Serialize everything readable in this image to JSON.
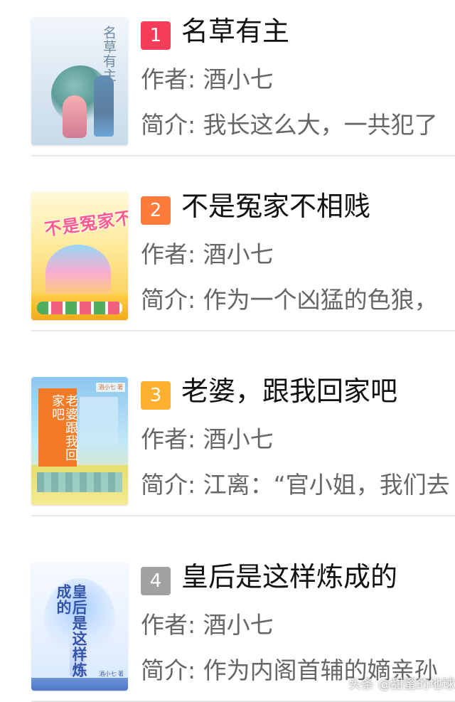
{
  "books": [
    {
      "rank": "1",
      "title": "名草有主",
      "author": "作者: 酒小七",
      "intro": "简介: 我长这么大，一共犯了",
      "rank_color": "#f63c58",
      "cover_text": "名草有主",
      "cover_author": "",
      "cover_theme": "campus"
    },
    {
      "rank": "2",
      "title": "不是冤家不相贱",
      "author": "作者: 酒小七",
      "intro": "简介: 作为一个凶猛的色狼，",
      "rank_color": "#ff7b3c",
      "cover_text": "不是冤家不相贱",
      "cover_author": "",
      "cover_theme": "cartoon"
    },
    {
      "rank": "3",
      "title": "老婆，跟我回家吧",
      "author": "作者: 酒小七",
      "intro": "简介: 江离：“官小姐，我们去",
      "rank_color": "#ffb02f",
      "cover_text": "老婆跟我回家吧",
      "cover_author": "酒小七 著",
      "cover_theme": "school"
    },
    {
      "rank": "4",
      "title": "皇后是这样炼成的",
      "author": "作者: 酒小七",
      "intro": "简介: 作为内阁首辅的嫡亲孙",
      "rank_color": "#a1a1a1",
      "cover_text": "皇后是这样炼成的",
      "cover_author": "酒小七 著",
      "cover_theme": "palace"
    }
  ],
  "watermark": "头条 @甜蜜的地球"
}
